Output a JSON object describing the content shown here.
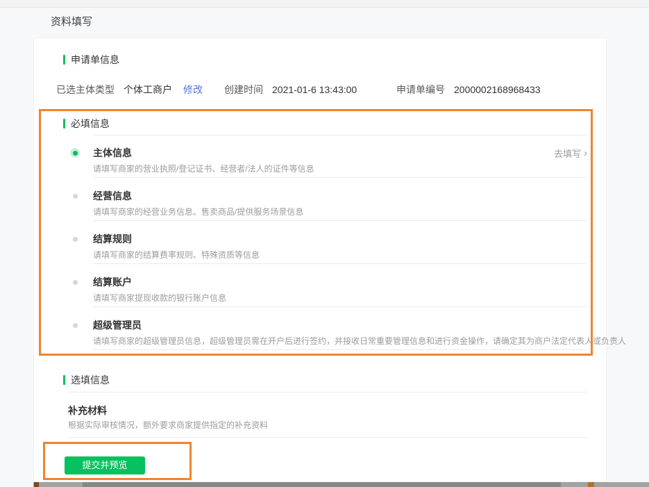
{
  "page": {
    "title": "资料填写"
  },
  "colors": {
    "accent_green": "#07C160",
    "highlight_orange": "#ED8432",
    "link_blue": "#5574D6",
    "text_dark": "#333333",
    "text_gray": "#9C9C9C"
  },
  "icons": {
    "chevron_right": "›"
  },
  "application_info": {
    "section_title": "申请单信息",
    "subject_type_label": "已选主体类型",
    "subject_type_value": "个体工商户",
    "modify_link": "修改",
    "created_label": "创建时间",
    "created_value": "2021-01-6 13:43:00",
    "application_no_label": "申请单编号",
    "application_no_value": "2000002168968433"
  },
  "required_info": {
    "section_title": "必填信息",
    "go_fill_label": "去填写",
    "items": [
      {
        "title": "主体信息",
        "desc": "请填写商家的营业执照/登记证书、经营者/法人的证件等信息",
        "state": "selected"
      },
      {
        "title": "经营信息",
        "desc": "请填写商家的经营业务信息、售卖商品/提供服务场景信息",
        "state": "unselected"
      },
      {
        "title": "结算规则",
        "desc": "请填写商家的结算费率规则、特殊资质等信息",
        "state": "unselected"
      },
      {
        "title": "结算账户",
        "desc": "请填写商家提现收款的银行账户信息",
        "state": "unselected"
      },
      {
        "title": "超级管理员",
        "desc": "请填写商家的超级管理员信息，超级管理员需在开户后进行签约，并接收日常重要管理信息和进行资金操作，请确定其为商户法定代表人或负责人",
        "state": "unselected"
      }
    ]
  },
  "optional_info": {
    "section_title": "选填信息",
    "items": [
      {
        "title": "补充材料",
        "desc": "根据实际审核情况，额外要求商家提供指定的补充资料"
      }
    ]
  },
  "footer": {
    "submit_label": "提交并预览"
  }
}
